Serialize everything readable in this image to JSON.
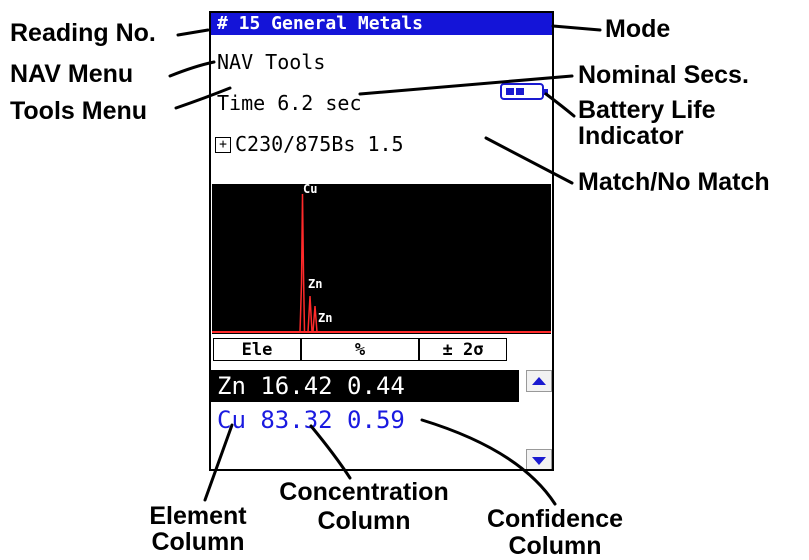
{
  "device": {
    "title": "# 15 General Metals",
    "menu": "NAV Tools",
    "time": "Time 6.2 sec",
    "plus_symbol": "+",
    "match": "C230/875Bs 1.5",
    "spectrum_labels": [
      "Cu",
      "Zn",
      "Zn"
    ],
    "table_headers": [
      "Ele",
      "%",
      "± 2σ"
    ],
    "rows": [
      {
        "text": "Zn 16.42 0.44",
        "selected": true
      },
      {
        "text": "Cu 83.32 0.59",
        "selected": false
      }
    ],
    "scroll_up": "▲",
    "scroll_down": "▼",
    "colors": {
      "title_bar": "#1414d8",
      "selected_row": "#000000",
      "row_text_blue": "#1a1ae0",
      "spectrum_line": "#ff2a2a"
    }
  },
  "callouts": {
    "reading_no": "Reading No.",
    "nav_menu": "NAV Menu",
    "tools_menu": "Tools Menu",
    "mode": "Mode",
    "nominal_secs": "Nominal Secs.",
    "battery_line1": "Battery Life",
    "battery_line2": "Indicator",
    "match_no_match": "Match/No Match",
    "element_line1": "Element",
    "element_line2": "Column",
    "concentration_line1": "Concentration",
    "concentration_line2": "Column",
    "confidence_line1": "Confidence",
    "confidence_line2": "Column"
  }
}
